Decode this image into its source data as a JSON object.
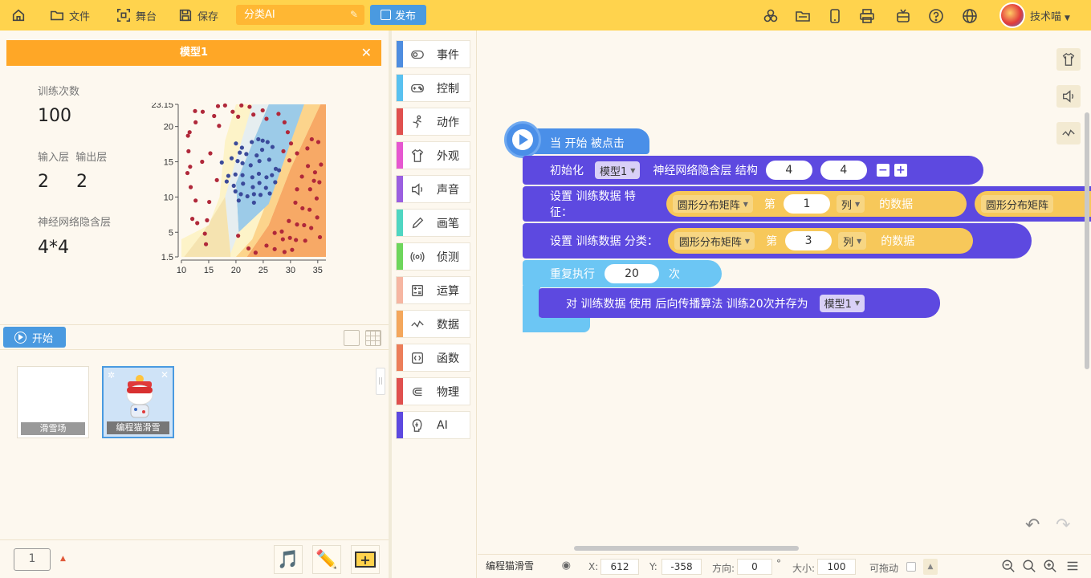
{
  "toolbar": {
    "file_label": "文件",
    "stage_label": "舞台",
    "save_label": "保存",
    "project_title": "分类AI",
    "publish_label": "发布",
    "username": "技术喵"
  },
  "model_panel": {
    "title": "模型1",
    "train_count_label": "训练次数",
    "train_count": "100",
    "io_label": "输入层  输出层",
    "input_layer": "2",
    "output_layer": "2",
    "hidden_label": "神经网络隐含层",
    "hidden_value": "4*4"
  },
  "chart_data": {
    "type": "scatter",
    "title": "",
    "x_ticks": [
      "10",
      "15",
      "20",
      "25",
      "30",
      "35"
    ],
    "y_ticks": [
      "1.5",
      "5",
      "10",
      "15",
      "20",
      "23.15"
    ],
    "xlim": [
      10,
      36.5
    ],
    "ylim": [
      1.5,
      23.15
    ],
    "series": [
      {
        "name": "",
        "color": "#b0283a",
        "points": [
          [
            12.5,
            22.2
          ],
          [
            13.9,
            22.1
          ],
          [
            16.7,
            22.9
          ],
          [
            18,
            23
          ],
          [
            21,
            23
          ],
          [
            22.5,
            22.8
          ],
          [
            24.9,
            22.3
          ],
          [
            25.6,
            21.1
          ],
          [
            27.8,
            21.8
          ],
          [
            28.9,
            20.6
          ],
          [
            29.5,
            19.2
          ],
          [
            30.1,
            17.6
          ],
          [
            28.7,
            16.5
          ],
          [
            29.8,
            15.2
          ],
          [
            31.2,
            16.2
          ],
          [
            33.1,
            16.9
          ],
          [
            33.9,
            18.2
          ],
          [
            35.1,
            17.8
          ],
          [
            33.2,
            14.4
          ],
          [
            34.5,
            13.5
          ],
          [
            35.6,
            14.6
          ],
          [
            32.1,
            12.9
          ],
          [
            34.3,
            12.3
          ],
          [
            35.3,
            12.1
          ],
          [
            31.2,
            11.1
          ],
          [
            33.6,
            11.1
          ],
          [
            30.9,
            9.2
          ],
          [
            32.2,
            8.4
          ],
          [
            33.5,
            8.2
          ],
          [
            34.8,
            9.8
          ],
          [
            34.9,
            7.1
          ],
          [
            29.7,
            6.6
          ],
          [
            31.2,
            6.1
          ],
          [
            32.5,
            6
          ],
          [
            33.8,
            5.6
          ],
          [
            35.4,
            4.3
          ],
          [
            27.1,
            4.9
          ],
          [
            28.4,
            5.1
          ],
          [
            28.6,
            4
          ],
          [
            29.9,
            4.2
          ],
          [
            31,
            3.9
          ],
          [
            32.7,
            3.8
          ],
          [
            25.6,
            3.1
          ],
          [
            27.1,
            2.6
          ],
          [
            28.9,
            2.2
          ],
          [
            30.3,
            2.5
          ],
          [
            20.4,
            4.5
          ],
          [
            22.3,
            2.7
          ],
          [
            23.6,
            2.1
          ],
          [
            14.5,
            3.3
          ],
          [
            14.3,
            4.8
          ],
          [
            12,
            6.9
          ],
          [
            12.9,
            6.3
          ],
          [
            12.6,
            9.5
          ],
          [
            11.7,
            11.4
          ],
          [
            11.1,
            13.4
          ],
          [
            11.6,
            14.3
          ],
          [
            11.3,
            16.5
          ],
          [
            11.2,
            18.7
          ],
          [
            11.5,
            19.2
          ],
          [
            12.6,
            20.6
          ],
          [
            16,
            21.5
          ],
          [
            16.9,
            20.1
          ],
          [
            19.4,
            22.1
          ],
          [
            20.4,
            21.4
          ],
          [
            23.2,
            21.7
          ],
          [
            15.3,
            16.2
          ],
          [
            13.8,
            15
          ],
          [
            16.5,
            12.4
          ],
          [
            15.1,
            9.3
          ],
          [
            14.7,
            6.7
          ]
        ]
      },
      {
        "name": "",
        "color": "#3b4a9a",
        "points": [
          [
            20,
            17.6
          ],
          [
            21.1,
            17
          ],
          [
            22.9,
            17.8
          ],
          [
            24.1,
            18.2
          ],
          [
            24.9,
            18
          ],
          [
            25.8,
            17.8
          ],
          [
            26.7,
            17.1
          ],
          [
            24.8,
            16.7
          ],
          [
            23.8,
            15.9
          ],
          [
            21.9,
            16.1
          ],
          [
            20.7,
            16.3
          ],
          [
            19.2,
            15.5
          ],
          [
            17.4,
            14.9
          ],
          [
            20.3,
            15.1
          ],
          [
            21.2,
            14.8
          ],
          [
            22.7,
            14.5
          ],
          [
            24.3,
            15.1
          ],
          [
            26.1,
            15.3
          ],
          [
            27.3,
            14
          ],
          [
            26.6,
            13.1
          ],
          [
            25.6,
            12.8
          ],
          [
            24.2,
            13.3
          ],
          [
            23,
            12.8
          ],
          [
            21.2,
            13.1
          ],
          [
            19.9,
            13.2
          ],
          [
            18.6,
            13
          ],
          [
            18.3,
            12.2
          ],
          [
            19.6,
            11.6
          ],
          [
            21.3,
            11.9
          ],
          [
            23.1,
            11.4
          ],
          [
            24.3,
            12
          ],
          [
            25.5,
            11.3
          ],
          [
            26.2,
            10.5
          ],
          [
            24.5,
            10.3
          ],
          [
            23.3,
            10.4
          ],
          [
            22.1,
            10.1
          ],
          [
            20.9,
            10.4
          ],
          [
            19.9,
            10.8
          ],
          [
            20.5,
            9.5
          ],
          [
            23.3,
            9.2
          ],
          [
            27.2,
            12.1
          ],
          [
            27.9,
            13.8
          ]
        ]
      }
    ]
  },
  "sprite_bar": {
    "start_label": "开始",
    "sprites": [
      {
        "name": "滑雪场"
      },
      {
        "name": "编程猫滑雪"
      }
    ],
    "page": "1"
  },
  "categories": [
    {
      "label": "事件",
      "color": "#4e8de0"
    },
    {
      "label": "控制",
      "color": "#59c1f0"
    },
    {
      "label": "动作",
      "color": "#e0504f"
    },
    {
      "label": "外观",
      "color": "#e657d0"
    },
    {
      "label": "声音",
      "color": "#9b5fe0"
    },
    {
      "label": "画笔",
      "color": "#4fd6c2"
    },
    {
      "label": "侦测",
      "color": "#6ed65c"
    },
    {
      "label": "运算",
      "color": "#f6b6a2"
    },
    {
      "label": "数据",
      "color": "#f4a75c"
    },
    {
      "label": "函数",
      "color": "#ec7e5a"
    },
    {
      "label": "物理",
      "color": "#e0504f"
    },
    {
      "label": "AI",
      "color": "#5d49e0"
    }
  ],
  "blocks": {
    "hat": "当 开始 被点击",
    "init_label": "初始化",
    "init_model": "模型1",
    "init_hidden": "神经网络隐含层 结构",
    "init_v1": "4",
    "init_v2": "4",
    "feat_label": "设置 训练数据 特征：",
    "matrix1": "圆形分布矩阵",
    "nth": "第",
    "feat_col": "1",
    "col_label": "列",
    "data_of": "的数据",
    "matrix2": "圆形分布矩阵",
    "cls_label": "设置 训练数据 分类：",
    "cls_col": "3",
    "repeat_label": "重复执行",
    "repeat_n": "20",
    "times": "次",
    "train_stmt": "对 训练数据 使用 后向传播算法 训练20次并存为",
    "train_model": "模型1"
  },
  "status": {
    "sprite_name": "编程猫滑雪",
    "x_label": "X:",
    "x_val": "612",
    "y_label": "Y:",
    "y_val": "-358",
    "dir_label": "方向:",
    "dir_val": "0",
    "deg": "°",
    "size_label": "大小:",
    "size_val": "100",
    "drag_label": "可拖动"
  }
}
